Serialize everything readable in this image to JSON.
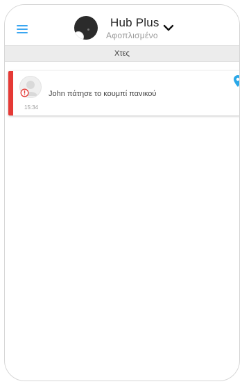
{
  "header": {
    "hub_name": "Hub Plus",
    "hub_status": "Αφοπλισμένο"
  },
  "date_section": {
    "label": "Χτες"
  },
  "events": [
    {
      "text": "John πάτησε το κουμπί πανικού",
      "time": "15:34",
      "accent_color": "#e53935"
    }
  ],
  "colors": {
    "accent": "#3aa6f1",
    "alarm": "#e53935",
    "location_pin": "#2aa8e8"
  },
  "icons": [
    "menu-icon",
    "hub-avatar",
    "chevron-down-icon",
    "user-avatar",
    "alert-icon",
    "location-pin-icon"
  ]
}
